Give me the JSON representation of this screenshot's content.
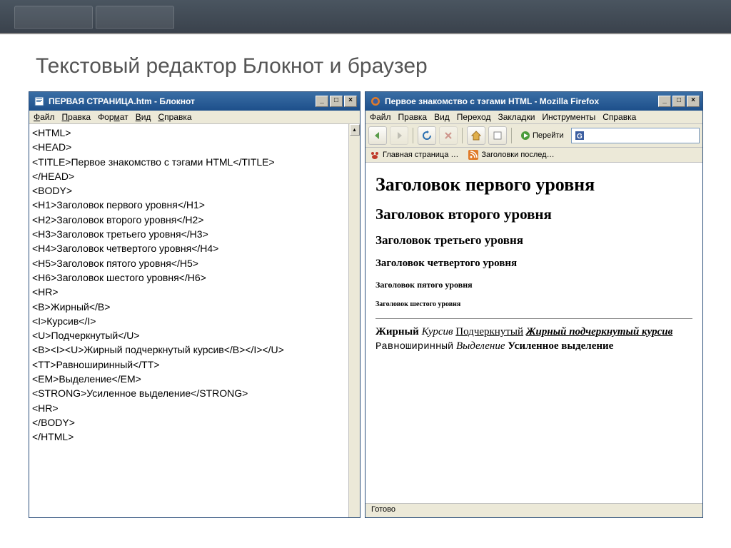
{
  "slide": {
    "title": "Текстовый редактор Блокнот и браузер"
  },
  "notepad": {
    "title": "ПЕРВАЯ СТРАНИЦА.htm - Блокнот",
    "menu": {
      "file": "Файл",
      "edit": "Правка",
      "format": "Формат",
      "view": "Вид",
      "help": "Справка"
    },
    "code": "<HTML>\n<HEAD>\n<TITLE>Первое знакомство с тэгами HTML</TITLE>\n</HEAD>\n<BODY>\n<H1>Заголовок первого уровня</H1>\n<H2>Заголовок второго уровня</H2>\n<H3>Заголовок третьего уровня</H3>\n<H4>Заголовок четвертого уровня</H4>\n<H5>Заголовок пятого уровня</H5>\n<H6>Заголовок шестого уровня</H6>\n<HR>\n<B>Жирный</B>\n<I>Курсив</I>\n<U>Подчеркнутый</U>\n<B><I><U>Жирный подчеркнутый курсив</B></I></U>\n<TT>Равноширинный</TT>\n<EM>Выделение</EM>\n<STRONG>Усиленное выделение</STRONG>\n<HR>\n</BODY>\n</HTML>"
  },
  "browser": {
    "title": "Первое знакомство с тэгами HTML - Mozilla Firefox",
    "menu": {
      "file": "Файл",
      "edit": "Правка",
      "view": "Вид",
      "go": "Переход",
      "bookmarks": "Закладки",
      "tools": "Инструменты",
      "help": "Справка"
    },
    "go_label": "Перейти",
    "bookmarks": {
      "home": "Главная страница …",
      "headlines": "Заголовки послед…"
    },
    "page": {
      "h1": "Заголовок первого уровня",
      "h2": "Заголовок второго уровня",
      "h3": "Заголовок третьего уровня",
      "h4": "Заголовок четвертого уровня",
      "h5": "Заголовок пятого уровня",
      "h6": "Заголовок шестого уровня",
      "bold": "Жирный",
      "italic": "Курсив",
      "underline": "Подчеркнутый",
      "biu": "Жирный подчеркнутый курсив",
      "tt": "Равноширинный",
      "em": "Выделение",
      "strong": "Усиленное выделение"
    },
    "status": "Готово"
  },
  "win_controls": {
    "min": "_",
    "max": "□",
    "close": "×"
  }
}
